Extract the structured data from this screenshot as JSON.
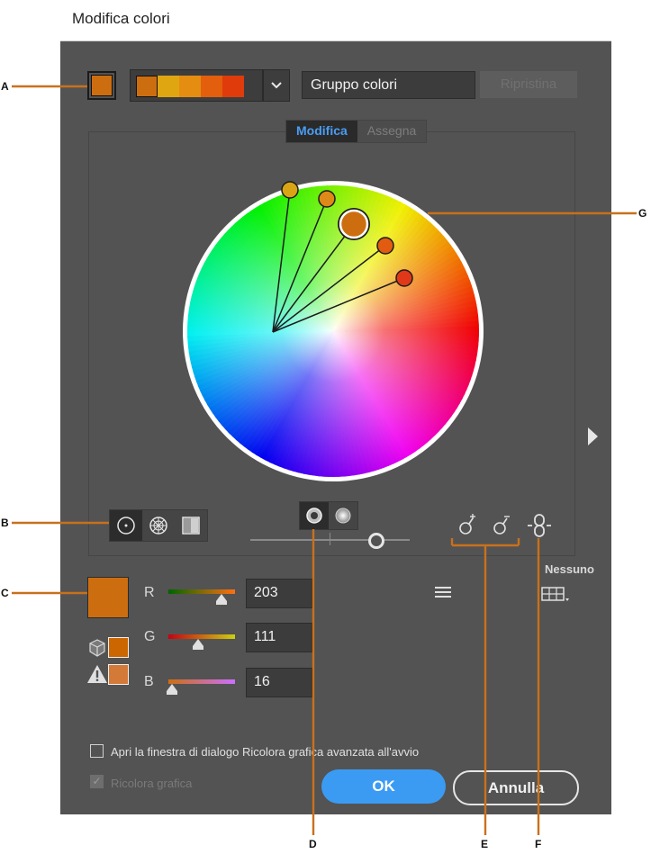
{
  "dialog": {
    "title": "Modifica colori",
    "group_name": "Gruppo colori",
    "reset_label": "Ripristina",
    "active_swatch_color": "#cc6e10",
    "group_swatches": [
      "#cc6e10",
      "#e0a612",
      "#e48d10",
      "#e35e0d",
      "#df3b0b"
    ]
  },
  "tabs": [
    {
      "label": "Modifica",
      "active": true
    },
    {
      "label": "Assegna",
      "active": false
    }
  ],
  "wheel": {
    "harmony_colors": [
      "#d9a514",
      "#de8a18",
      "#cc6e10",
      "#e15c10",
      "#e03818"
    ]
  },
  "wheel_modes": [
    "smooth-wheel-icon",
    "segmented-wheel-icon",
    "color-bars-icon"
  ],
  "display_modes": [
    "brightness-hue-icon",
    "saturation-hue-icon"
  ],
  "color_tools": [
    "add-color-tool-icon",
    "remove-color-tool-icon",
    "link-harmony-icon"
  ],
  "channels": [
    {
      "label": "R",
      "value": "203",
      "fraction": 0.8
    },
    {
      "label": "G",
      "value": "111",
      "fraction": 0.44
    },
    {
      "label": "B",
      "value": "16",
      "fraction": 0.06
    }
  ],
  "current_color": "#cc6e10",
  "web_color": "#cc6600",
  "gamut_color": "#d37a39",
  "limit_label": "Nessuno",
  "options": {
    "open_advanced_label": "Apri la finestra di dialogo Ricolora grafica avanzata all'avvio",
    "open_advanced_checked": false,
    "recolor_label": "Ricolora grafica",
    "recolor_checked": true
  },
  "buttons": {
    "ok": "OK",
    "cancel": "Annulla"
  },
  "callouts": {
    "color": "#c8711c",
    "labels": {
      "a": "A",
      "b": "B",
      "c": "C",
      "d": "D",
      "e": "E",
      "f": "F",
      "g": "G"
    }
  }
}
